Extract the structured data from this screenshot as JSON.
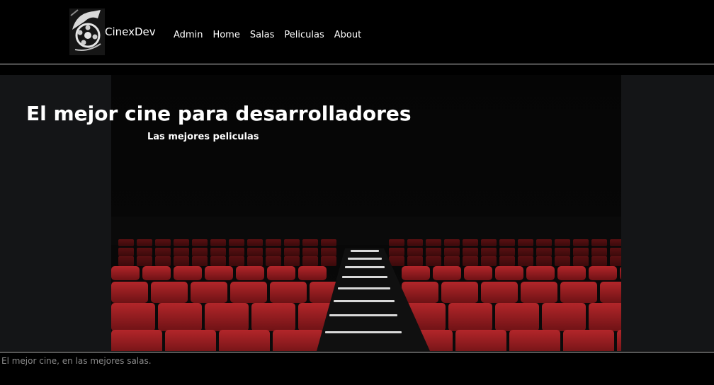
{
  "navbar": {
    "brand": "CinexDev",
    "links": [
      {
        "label": "Admin"
      },
      {
        "label": "Home"
      },
      {
        "label": "Salas"
      },
      {
        "label": "Peliculas"
      },
      {
        "label": "About"
      }
    ]
  },
  "hero": {
    "title": "El mejor cine para desarrolladores",
    "subtitle": "Las mejores peliculas"
  },
  "footer": {
    "text": "El mejor cine, en las mejores salas."
  },
  "colors": {
    "background": "#000000",
    "hero_side": "#141517",
    "seat_red": "#9b1c1f",
    "divider": "#cfcfcf",
    "footer_text": "#8a8a8a"
  },
  "icons": {
    "logo": "cinema-reel-logo-icon"
  }
}
